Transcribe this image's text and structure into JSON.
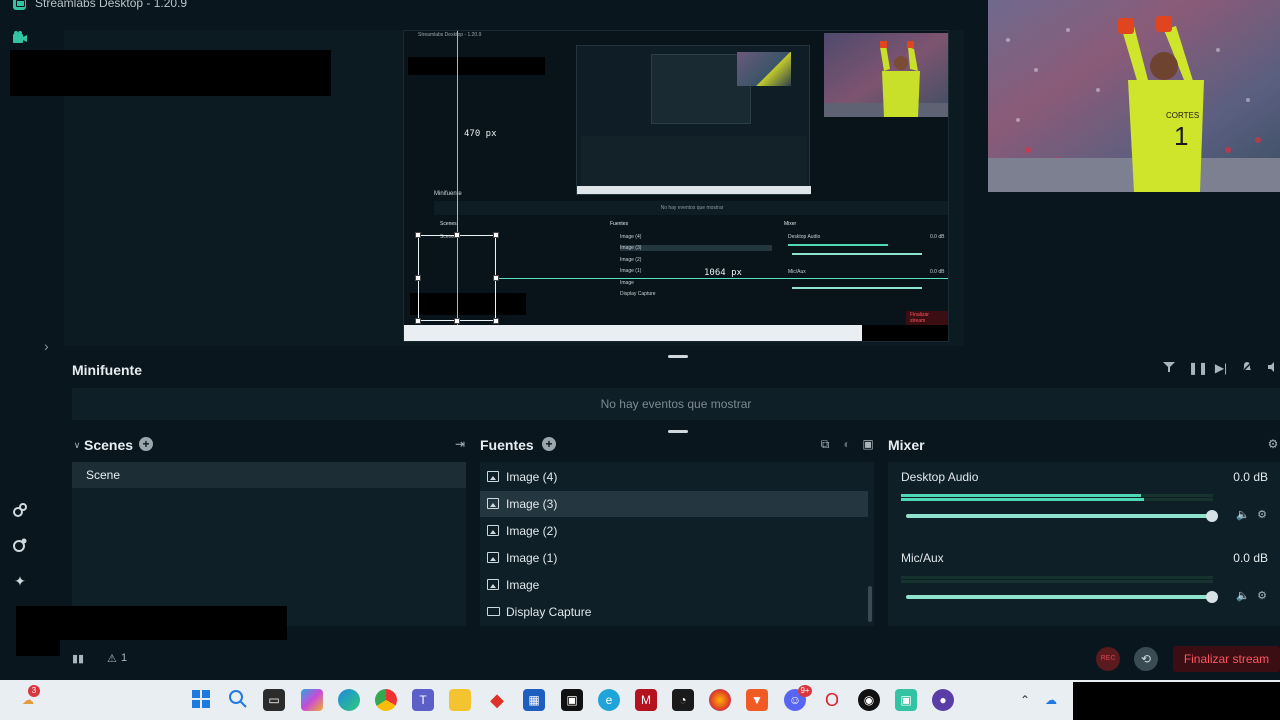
{
  "app": {
    "title": "Streamlabs Desktop - 1.20.9"
  },
  "nested_preview": {
    "title": "Streamlabs Desktop - 1.20.9",
    "dim_vertical": "470 px",
    "dim_horizontal": "1064 px",
    "minifuente": "Minifuente",
    "empty": "No hay eventos que mostrar",
    "scenes": "Scenes",
    "scene": "Scene",
    "fuentes": "Fuentes",
    "sources": [
      "Image (4)",
      "Image (3)",
      "Image (2)",
      "Image (1)",
      "Image",
      "Display Capture"
    ],
    "mixer": "Mixer",
    "desktop_audio": "Desktop Audio",
    "mic": "Mic/Aux",
    "db": "0.0 dB",
    "stop": "Finalizar stream"
  },
  "minifuente": {
    "label": "Minifuente",
    "empty": "No hay eventos que mostrar"
  },
  "scenes": {
    "title": "Scenes",
    "items": [
      "Scene"
    ]
  },
  "sources": {
    "title": "Fuentes",
    "items": [
      {
        "label": "Image (4)",
        "icon": "image-icon"
      },
      {
        "label": "Image (3)",
        "icon": "image-icon",
        "selected": true
      },
      {
        "label": "Image (2)",
        "icon": "image-icon"
      },
      {
        "label": "Image (1)",
        "icon": "image-icon"
      },
      {
        "label": "Image",
        "icon": "image-icon"
      },
      {
        "label": "Display Capture",
        "icon": "monitor-icon"
      }
    ]
  },
  "mixer": {
    "title": "Mixer",
    "channels": [
      {
        "name": "Desktop Audio",
        "db": "0.0 dB",
        "level": 0.77,
        "volume": 1.0
      },
      {
        "name": "Mic/Aux",
        "db": "0.0 dB",
        "level": 0.0,
        "volume": 1.0
      }
    ]
  },
  "footer": {
    "rec": "REC",
    "stop_label": "Finalizar stream",
    "warnings": "1"
  },
  "taskbar": {
    "weather_badge": "3",
    "discord_badge": "9+"
  },
  "colors": {
    "accent": "#31c3a2",
    "danger": "#ff5560",
    "bg": "#09161d",
    "panel": "#0f1f27"
  }
}
